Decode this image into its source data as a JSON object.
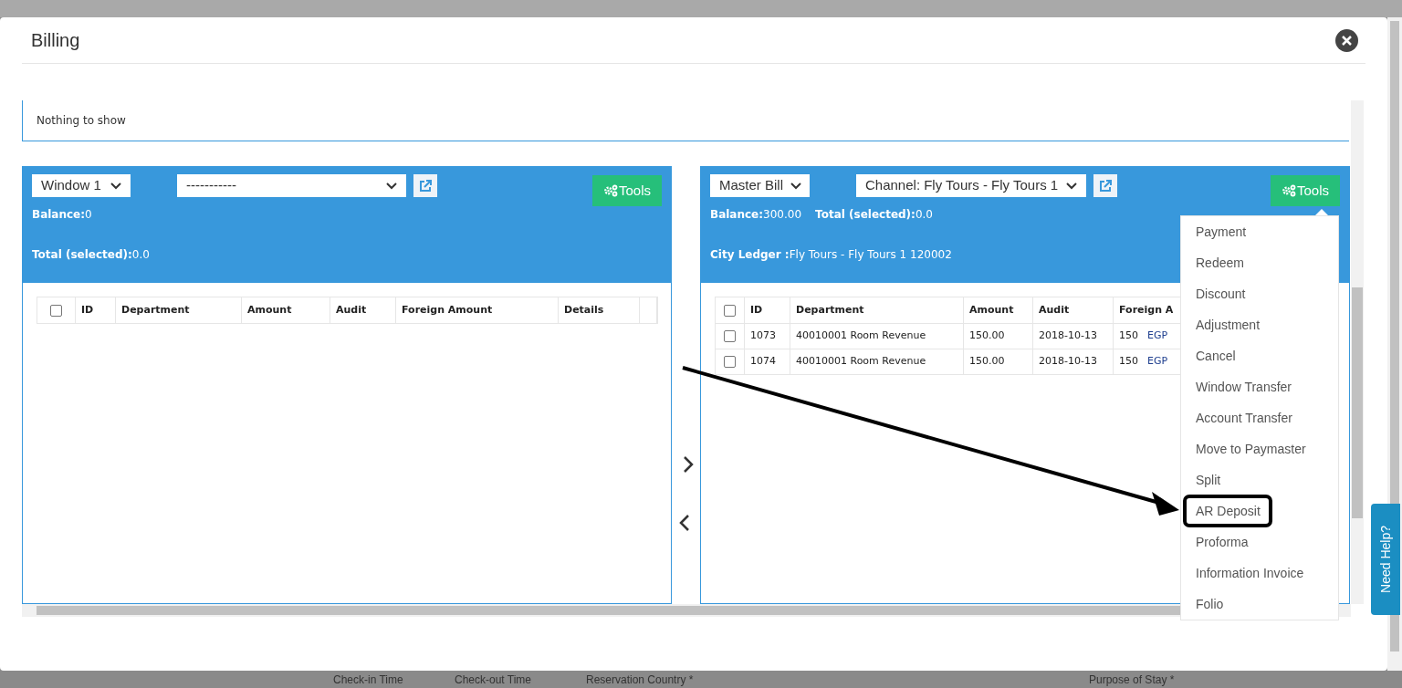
{
  "dialog": {
    "title": "Billing"
  },
  "message": "Nothing to show",
  "panels": [
    {
      "window_select": "Window 1",
      "account_select": "-----------",
      "tools_label": "Tools",
      "info_lines": [
        [
          "**Balance:**0"
        ],
        [
          "**Total (selected):**0.0"
        ]
      ],
      "select_all_checked": false,
      "columns": [
        "ID",
        "Department",
        "Amount",
        "Audit",
        "Foreign Amount",
        "Details",
        ""
      ]
    },
    {
      "window_select": "Master Bill",
      "account_select": "Channel: Fly Tours - Fly Tours 1",
      "tools_label": "Tools",
      "info_lines": [
        [
          "**Balance:**300.00",
          "**Total (selected):**0.0"
        ],
        [
          "**City Ledger :**Fly Tours - Fly Tours 1 120002"
        ]
      ],
      "select_all_checked": false,
      "columns": [
        "ID",
        "Department",
        "Amount",
        "Audit",
        "Foreign A"
      ],
      "rows": [
        {
          "checked": false,
          "id": "1073",
          "department": "40010001 Room Revenue",
          "amount": "150.00",
          "audit": "2018-10-13",
          "foreign_amount": "150",
          "currency": "EGP"
        },
        {
          "checked": false,
          "id": "1074",
          "department": "40010001 Room Revenue",
          "amount": "150.00",
          "audit": "2018-10-13",
          "foreign_amount": "150",
          "currency": "EGP"
        }
      ],
      "menu_items": [
        {
          "label": "Payment",
          "annotated": false
        },
        {
          "label": "Redeem",
          "annotated": false
        },
        {
          "label": "Discount",
          "annotated": false
        },
        {
          "label": "Adjustment",
          "annotated": false
        },
        {
          "label": "Cancel",
          "annotated": false
        },
        {
          "label": "Window Transfer",
          "annotated": false
        },
        {
          "label": "Account Transfer",
          "annotated": false
        },
        {
          "label": "Move to Paymaster",
          "annotated": false
        },
        {
          "label": "Split",
          "annotated": false
        },
        {
          "label": "AR Deposit",
          "annotated": true
        },
        {
          "label": "Proforma",
          "annotated": false
        },
        {
          "label": "Information Invoice",
          "annotated": false
        },
        {
          "label": "Folio",
          "annotated": false
        }
      ]
    }
  ],
  "help_tab": "Need Help?",
  "background_labels": [
    "Check-in Time",
    "Check-out Time",
    "Reservation Country *",
    "Purpose of Stay *"
  ]
}
